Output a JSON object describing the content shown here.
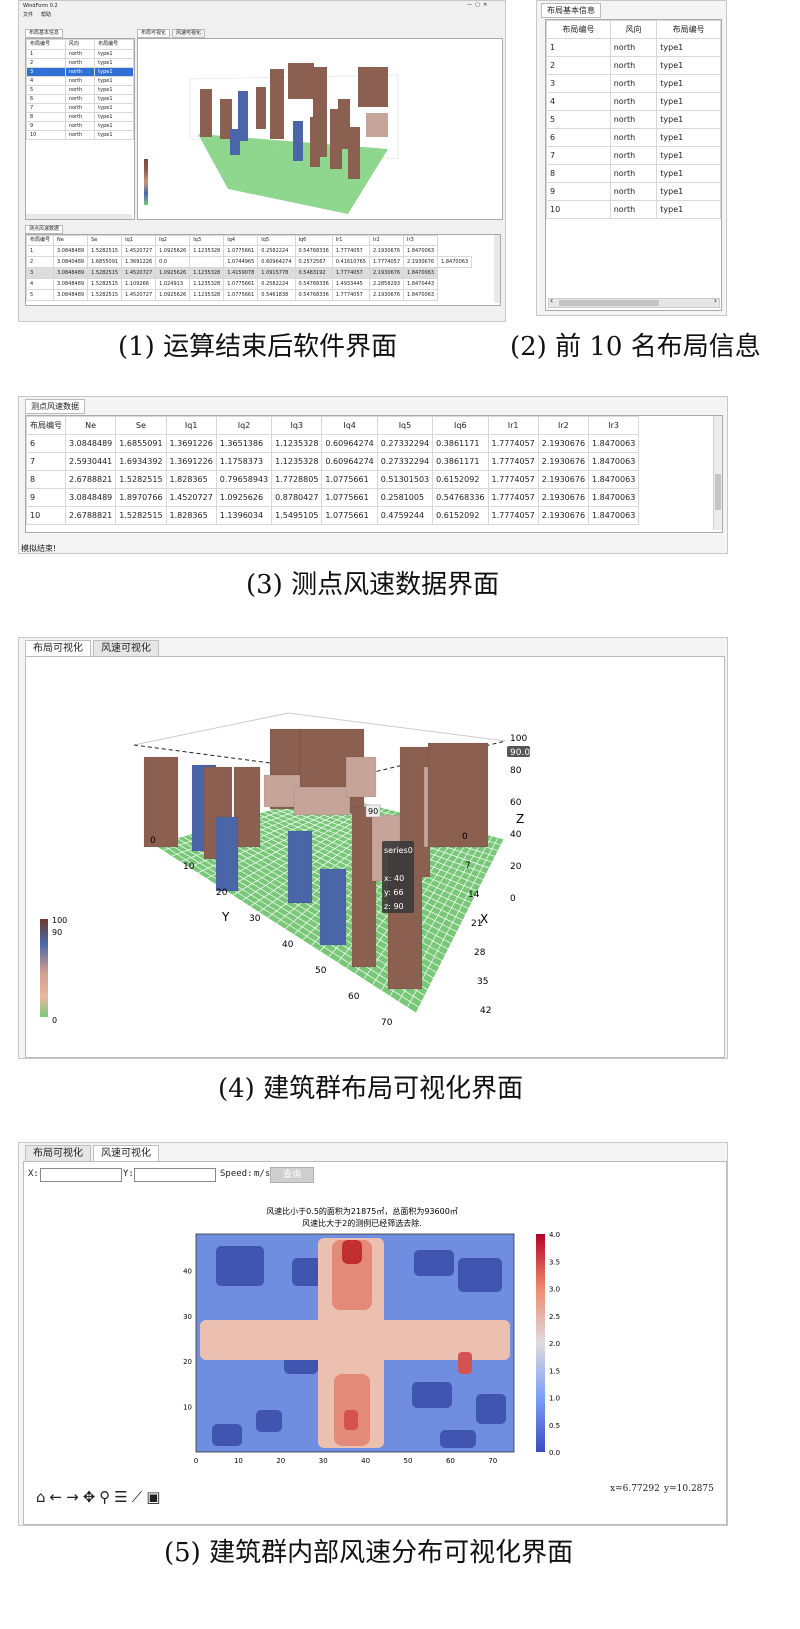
{
  "p1": {
    "title": "WindForm 0.2",
    "menu": [
      "文件",
      "帮助"
    ],
    "left_tab": "布局基本信息",
    "left_cols": [
      "布局编号",
      "风向",
      "布局编号"
    ],
    "rows": [
      [
        "1",
        "north",
        "type1"
      ],
      [
        "2",
        "north",
        "type1"
      ],
      [
        "3",
        "north",
        "type1"
      ],
      [
        "4",
        "north",
        "type1"
      ],
      [
        "5",
        "north",
        "type1"
      ],
      [
        "6",
        "north",
        "type1"
      ],
      [
        "7",
        "north",
        "type1"
      ],
      [
        "8",
        "north",
        "type1"
      ],
      [
        "9",
        "north",
        "type1"
      ],
      [
        "10",
        "north",
        "type1"
      ]
    ],
    "viz_tabs": [
      "布局可视化",
      "风速可视化"
    ],
    "bottom_tab": "测点风速数据",
    "bottom_cols": [
      "布局编号",
      "Ne",
      "Se",
      "Iq1",
      "Iq2",
      "Iq3",
      "Iq4",
      "Iq5",
      "Iq6",
      "Ir1",
      "Ir2",
      "Ir3"
    ],
    "bottom_rows": [
      [
        "1",
        "3.0848489",
        "1.5282515",
        "1.4520727",
        "1.0925626",
        "1.1235328",
        "1.0775661",
        "0.2582224",
        "0.54768336",
        "1.7774057",
        "2.1930676",
        "1.8470063"
      ],
      [
        "2",
        "3.0840489",
        "1.6855091",
        "1.3691226",
        "0.0",
        "",
        "1.0744965",
        "0.60964274",
        "0.2572567",
        "0.41610765",
        "1.7774057",
        "2.1930676",
        "1.8470063"
      ],
      [
        "3",
        "3.0848489",
        "1.5282515",
        "1.4520727",
        "1.0925626",
        "1.1235328",
        "1.4159078",
        "1.0915778",
        "0.5483192",
        "1.7774057",
        "2.1930676",
        "1.8470063"
      ],
      [
        "4",
        "3.0848489",
        "1.5282515",
        "1.109266",
        "1.024913",
        "1.1235328",
        "1.0775661",
        "0.2582224",
        "0.54768336",
        "1.4933445",
        "2.2858293",
        "1.8470443"
      ],
      [
        "5",
        "3.0848489",
        "1.5282515",
        "1.4520727",
        "1.0925626",
        "1.1235328",
        "1.0775661",
        "0.5461838",
        "0.54768336",
        "1.7774057",
        "2.1930676",
        "1.8470063"
      ]
    ],
    "caption": "(1) 运算结束后软件界面"
  },
  "p2": {
    "tab": "布局基本信息",
    "cols": [
      "布局编号",
      "风向",
      "布局编号"
    ],
    "caption": "(2) 前 10 名布局信息"
  },
  "p3": {
    "tab": "测点风速数据",
    "cols": [
      "布局编号",
      "Ne",
      "Se",
      "Iq1",
      "Iq2",
      "Iq3",
      "Iq4",
      "Iq5",
      "Iq6",
      "Ir1",
      "Ir2",
      "Ir3"
    ],
    "rows": [
      [
        "6",
        "3.0848489",
        "1.6855091",
        "1.3691226",
        "1.3651386",
        "1.1235328",
        "0.60964274",
        "0.27332294",
        "0.3861171",
        "1.7774057",
        "2.1930676",
        "1.8470063"
      ],
      [
        "7",
        "2.5930441",
        "1.6934392",
        "1.3691226",
        "1.1758373",
        "1.1235328",
        "0.60964274",
        "0.27332294",
        "0.3861171",
        "1.7774057",
        "2.1930676",
        "1.8470063"
      ],
      [
        "8",
        "2.6788821",
        "1.5282515",
        "1.828365",
        "0.79658943",
        "1.7728805",
        "1.0775661",
        "0.51301503",
        "0.6152092",
        "1.7774057",
        "2.1930676",
        "1.8470063"
      ],
      [
        "9",
        "3.0848489",
        "1.8970766",
        "1.4520727",
        "1.0925626",
        "0.8780427",
        "1.0775661",
        "0.2581005",
        "0.54768336",
        "1.7774057",
        "2.1930676",
        "1.8470063"
      ],
      [
        "10",
        "2.6788821",
        "1.5282515",
        "1.828365",
        "1.1396034",
        "1.5495105",
        "1.0775661",
        "0.4759244",
        "0.6152092",
        "1.7774057",
        "2.1930676",
        "1.8470063"
      ]
    ],
    "status": "模拟结束!",
    "caption": "(3) 测点风速数据界面"
  },
  "p4": {
    "tabs": [
      "布局可视化",
      "风速可视化"
    ],
    "z_ticks": [
      "100",
      "80",
      "60",
      "40",
      "20",
      "0"
    ],
    "z_label": "Z",
    "z_value_badge": "90.00",
    "bar_label": "90",
    "x_ticks": [
      "0",
      "7",
      "14",
      "21",
      "28",
      "35",
      "42"
    ],
    "x_label": "X",
    "y_ticks": [
      "0",
      "10",
      "20",
      "30",
      "40",
      "50",
      "60",
      "70"
    ],
    "y_label": "Y",
    "tooltip": {
      "series": "series0",
      "x": "x: 40",
      "y": "y: 66",
      "z": "z: 90"
    },
    "legend": {
      "max": "100",
      "mark": "90",
      "min": "0"
    },
    "colors": {
      "building": "#8b6050",
      "building_light": "#c6a49a",
      "building_blue": "#4a66a8",
      "ground": "#78c878"
    },
    "caption": "(4) 建筑群布局可视化界面"
  },
  "p5": {
    "tabs": [
      "布局可视化",
      "风速可视化"
    ],
    "x_label": "X:",
    "y_label": "Y:",
    "speed_label": "Speed:",
    "unit": "m/s",
    "query_button": "查询",
    "title_line1": "风速比小于0.5的面积为21875㎡，总面积为93600㎡",
    "title_line2": "风速比大于2的测例已经筛选去除.",
    "x_ticks": [
      "0",
      "10",
      "20",
      "30",
      "40",
      "50",
      "60",
      "70"
    ],
    "y_ticks": [
      "40",
      "30",
      "20",
      "10"
    ],
    "cbar_ticks": [
      "4.0",
      "3.5",
      "3.0",
      "2.5",
      "2.0",
      "1.5",
      "1.0",
      "0.5",
      "0.0"
    ],
    "coord_x": "x=6.77292",
    "coord_y": "y=10.2875",
    "toolbar": [
      "home-icon",
      "back-icon",
      "forward-icon",
      "pan-icon",
      "zoom-icon",
      "configure-icon",
      "lines-icon",
      "save-icon"
    ],
    "caption": "(5) 建筑群内部风速分布可视化界面"
  }
}
